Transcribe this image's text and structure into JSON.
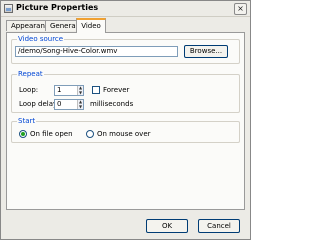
{
  "window": {
    "title": "Picture Properties",
    "close_glyph": "×"
  },
  "tabs": [
    {
      "label": "Appearance",
      "active": false
    },
    {
      "label": "General",
      "active": false
    },
    {
      "label": "Video",
      "active": true
    }
  ],
  "video_source": {
    "group_label": "Video source",
    "path": "/demo/Song-Hive-Color.wmv",
    "browse_label": "Browse..."
  },
  "repeat": {
    "group_label": "Repeat",
    "loop_label": "Loop:",
    "loop_value": "1",
    "forever_label": "Forever",
    "forever_checked": false,
    "loop_delay_label": "Loop delay:",
    "loop_delay_value": "0",
    "milliseconds_label": "milliseconds"
  },
  "start": {
    "group_label": "Start",
    "options": [
      {
        "label": "On file open",
        "selected": true
      },
      {
        "label": "On mouse over",
        "selected": false
      }
    ]
  },
  "footer": {
    "ok_label": "OK",
    "cancel_label": "Cancel"
  },
  "colors": {
    "group_label": "#0046d5",
    "active_tab_accent": "#f0a030",
    "radio_dot": "#21a121"
  }
}
